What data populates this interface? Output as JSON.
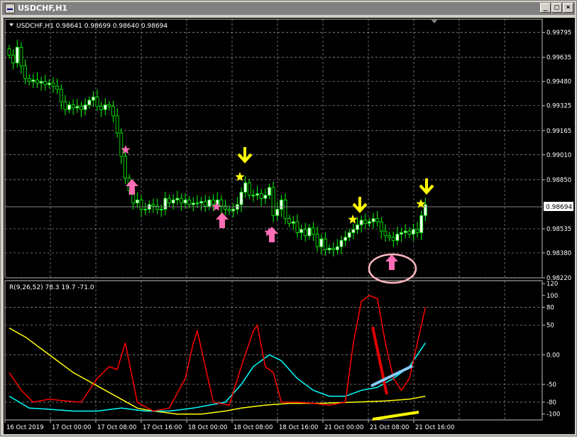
{
  "window": {
    "title": "USDCHF,H1",
    "minimize_label": "_",
    "maximize_label": "□",
    "close_label": "×"
  },
  "main_chart": {
    "header": "USDCHF,H1  0.98641 0.98699 0.98640 0.98694",
    "current_price_label": "0.98694",
    "price_ticks": [
      "0.99795",
      "0.99635",
      "0.99480",
      "0.99325",
      "0.99165",
      "0.99010",
      "0.98850",
      "0.98694",
      "0.98535",
      "0.98380",
      "0.98220"
    ],
    "colors": {
      "background": "#000000",
      "bull_candle": "#ffffff",
      "bear_candle": "#000000",
      "wick": "#00ff00",
      "grid": "#c0c0c0",
      "up_arrow": "#ff6eb4",
      "down_arrow": "#ffff00"
    }
  },
  "indicator": {
    "header": "R(9,26,52) 78.3 19.7 -71.0",
    "ticks": [
      "120",
      "100",
      "80",
      "50",
      "0.00",
      "-50",
      "-80",
      "-100"
    ],
    "colors": {
      "fast": "#ff0000",
      "mid": "#00ffff",
      "slow": "#ffff00"
    }
  },
  "time_axis": [
    "16 Oct 2019",
    "17 Oct 00:00",
    "17 Oct 08:00",
    "17 Oct 16:00",
    "18 Oct 00:00",
    "18 Oct 08:00",
    "18 Oct 16:00",
    "21 Oct 00:00",
    "21 Oct 08:00",
    "21 Oct 16:00"
  ],
  "chart_data": {
    "type": "candlestick",
    "symbol": "USDCHF",
    "timeframe": "H1",
    "ylim": [
      0.9822,
      0.9988
    ],
    "closes": [
      0.9965,
      0.996,
      0.997,
      0.9958,
      0.995,
      0.9948,
      0.9949,
      0.9947,
      0.9948,
      0.9946,
      0.9947,
      0.9945,
      0.9943,
      0.9935,
      0.993,
      0.9933,
      0.9931,
      0.9932,
      0.993,
      0.9933,
      0.9936,
      0.9938,
      0.9932,
      0.993,
      0.9933,
      0.9932,
      0.9926,
      0.9915,
      0.99,
      0.9886,
      0.9878,
      0.987,
      0.9872,
      0.9866,
      0.9866,
      0.9869,
      0.9868,
      0.9866,
      0.9866,
      0.9873,
      0.987,
      0.9872,
      0.9873,
      0.987,
      0.9872,
      0.9869,
      0.987,
      0.987,
      0.9871,
      0.9868,
      0.9872,
      0.9869,
      0.9872,
      0.9868,
      0.9866,
      0.9865,
      0.9866,
      0.9869,
      0.9877,
      0.9883,
      0.9875,
      0.9875,
      0.9876,
      0.9873,
      0.9875,
      0.988,
      0.9862,
      0.9866,
      0.9872,
      0.986,
      0.9857,
      0.9858,
      0.9851,
      0.9853,
      0.9849,
      0.9854,
      0.985,
      0.9842,
      0.9847,
      0.984,
      0.9841,
      0.984,
      0.9842,
      0.9846,
      0.9848,
      0.9851,
      0.9853,
      0.9856,
      0.9859,
      0.9857,
      0.9858,
      0.986,
      0.9858,
      0.9852,
      0.9849,
      0.9848,
      0.9846,
      0.985,
      0.9851,
      0.9852,
      0.985,
      0.9853,
      0.9851,
      0.9862,
      0.9869
    ]
  }
}
